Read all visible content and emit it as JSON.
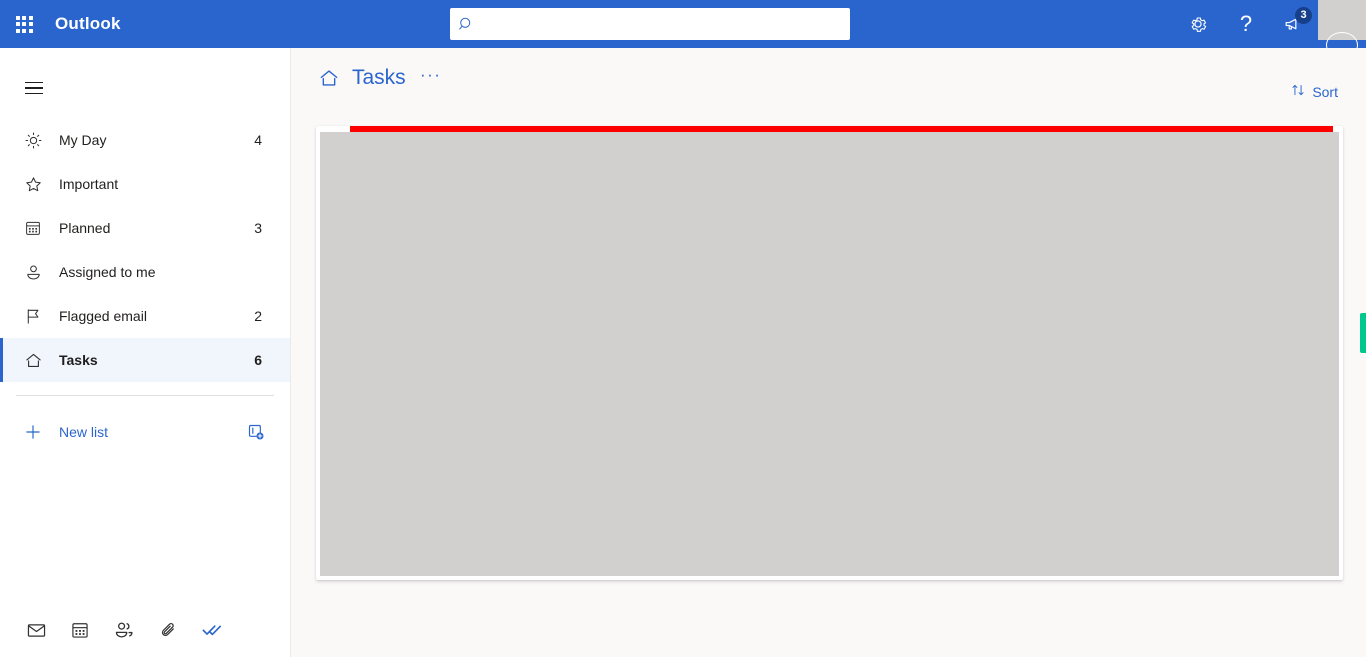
{
  "suite": {
    "waffle_icon": "waffle-grid-icon",
    "brand": "Outlook",
    "search": {
      "value": "",
      "placeholder": "",
      "icon": "search-icon"
    },
    "actions": [
      {
        "name": "settings",
        "icon": "gear-icon",
        "label": ""
      },
      {
        "name": "help",
        "icon": "question-mark-icon",
        "label": "?"
      },
      {
        "name": "notifications",
        "icon": "megaphone-icon",
        "badge": "3"
      }
    ],
    "avatar": {
      "icon": "avatar-placeholder",
      "label": ""
    }
  },
  "sidebar": {
    "menu_toggle_icon": "hamburger-icon",
    "items": [
      {
        "label": "My Day",
        "count": "4",
        "icon": "sun-icon",
        "selected": false
      },
      {
        "label": "Important",
        "count": "",
        "icon": "star-icon",
        "selected": false
      },
      {
        "label": "Planned",
        "count": "3",
        "icon": "calendar-icon",
        "selected": false
      },
      {
        "label": "Assigned to me",
        "count": "",
        "icon": "person-icon",
        "selected": false
      },
      {
        "label": "Flagged email",
        "count": "2",
        "icon": "flag-icon",
        "selected": false
      },
      {
        "label": "Tasks",
        "count": "6",
        "icon": "home-icon",
        "selected": true
      }
    ],
    "new_list": {
      "label": "New list",
      "plus_icon": "plus-icon",
      "new_group_icon": "new-group-icon"
    },
    "app_switcher": [
      {
        "name": "mail",
        "icon": "mail-icon",
        "active": false
      },
      {
        "name": "calendar",
        "icon": "calendar-icon",
        "active": false
      },
      {
        "name": "people",
        "icon": "people-icon",
        "active": false
      },
      {
        "name": "files",
        "icon": "paperclip-icon",
        "active": false
      },
      {
        "name": "todo",
        "icon": "double-check-icon",
        "active": true
      }
    ]
  },
  "main": {
    "home_icon": "home-icon",
    "title": "Tasks",
    "more_options": "···",
    "sort": {
      "label": "Sort",
      "icon": "sort-arrows-icon"
    }
  },
  "colors": {
    "brand_blue": "#2A65CE",
    "accent_link": "#2A65CE",
    "selected_row_bg": "#F0F6FC",
    "card_placeholder": "#D2D0CE",
    "red_bar": "#FF0000",
    "edge_indicator": "#00C88C",
    "page_bg": "#FAF9F8"
  }
}
